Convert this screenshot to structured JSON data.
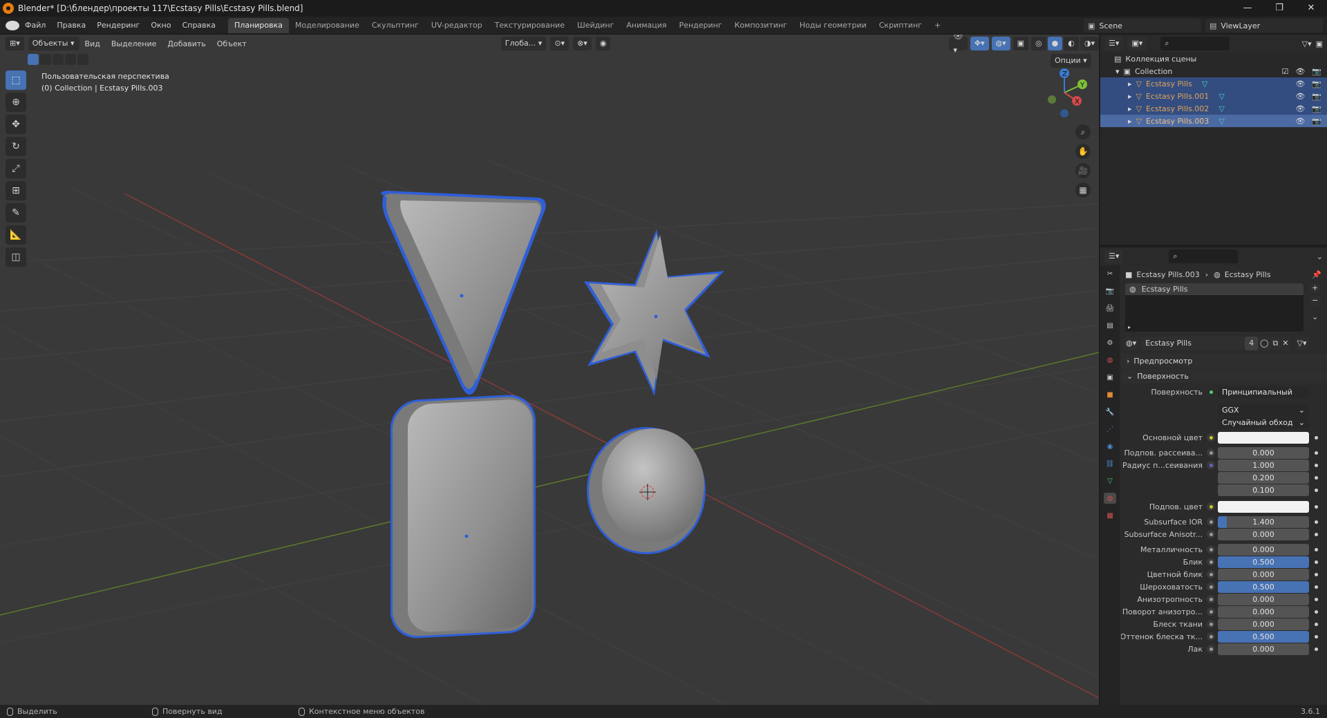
{
  "window": {
    "title": "Blender* [D:\\блендер\\проекты 117\\Ecstasy Pills\\Ecstasy Pills.blend]",
    "minimize": "—",
    "maximize": "❐",
    "close": "✕"
  },
  "menu": {
    "items": [
      "Файл",
      "Правка",
      "Рендеринг",
      "Окно",
      "Справка"
    ],
    "workspaces": [
      "Планировка",
      "Моделирование",
      "Скульптинг",
      "UV-редактор",
      "Текстурирование",
      "Шейдинг",
      "Анимация",
      "Рендеринг",
      "Композитинг",
      "Ноды геометрии",
      "Скриптинг",
      "+"
    ],
    "active_workspace": "Планировка",
    "scene": "Scene",
    "view_layer": "ViewLayer"
  },
  "viewport": {
    "mode": "Объекты",
    "menus": [
      "Вид",
      "Выделение",
      "Добавить",
      "Объект"
    ],
    "transform_orientation": "Глоба...",
    "options": "Опции",
    "info_line1": "Пользовательская перспектива",
    "info_line2": "(0) Collection | Ecstasy Pills.003",
    "gizmo": {
      "z": "Z",
      "y": "Y",
      "x": "X"
    }
  },
  "outliner": {
    "scene_collection": "Коллекция сцены",
    "collection": "Collection",
    "objects": [
      {
        "name": "Ecstasy Pills",
        "selected": true
      },
      {
        "name": "Ecstasy Pills.001",
        "selected": true
      },
      {
        "name": "Ecstasy Pills.002",
        "selected": true
      },
      {
        "name": "Ecstasy Pills.003",
        "selected": true,
        "active": true
      }
    ]
  },
  "properties": {
    "breadcrumb_object": "Ecstasy Pills.003",
    "breadcrumb_material": "Ecstasy Pills",
    "slot_name": "Ecstasy Pills",
    "material_name": "Ecstasy Pills",
    "user_count": "4",
    "section_preview": "Предпросмотр",
    "section_surface": "Поверхность",
    "surface_label": "Поверхность",
    "surface_value": "Принципиальный BSDF",
    "distribution": "GGX",
    "subsurface_method": "Случайный обход",
    "fields": [
      {
        "label": "Основной цвет",
        "value": "",
        "type": "color",
        "dot": "y"
      },
      {
        "label": "Подпов. рассеива...",
        "value": "0.000",
        "fill": 0,
        "dot": "g"
      },
      {
        "label": "Радиус п...сеивания",
        "value": "1.000",
        "fill": 0,
        "dot": "p"
      },
      {
        "label": "",
        "value": "0.200",
        "fill": 0,
        "dot": ""
      },
      {
        "label": "",
        "value": "0.100",
        "fill": 0,
        "dot": ""
      },
      {
        "label": "Подпов. цвет",
        "value": "",
        "type": "color",
        "dot": "y"
      },
      {
        "label": "Subsurface IOR",
        "value": "1.400",
        "fill": 0.1,
        "dot": "g"
      },
      {
        "label": "Subsurface Anisotr...",
        "value": "0.000",
        "fill": 0,
        "dot": "g"
      },
      {
        "label": "Металличность",
        "value": "0.000",
        "fill": 0,
        "dot": "g"
      },
      {
        "label": "Блик",
        "value": "0.500",
        "fill": 1,
        "dot": "g"
      },
      {
        "label": "Цветной блик",
        "value": "0.000",
        "fill": 0,
        "dot": "g"
      },
      {
        "label": "Шероховатость",
        "value": "0.500",
        "fill": 1,
        "dot": "g"
      },
      {
        "label": "Анизотропность",
        "value": "0.000",
        "fill": 0,
        "dot": "g"
      },
      {
        "label": "Поворот анизотро...",
        "value": "0.000",
        "fill": 0,
        "dot": "g"
      },
      {
        "label": "Блеск ткани",
        "value": "0.000",
        "fill": 0,
        "dot": "g"
      },
      {
        "label": "Оттенок блеска тк...",
        "value": "0.500",
        "fill": 1,
        "dot": "g"
      },
      {
        "label": "Лак",
        "value": "0.000",
        "fill": 0,
        "dot": "g"
      }
    ]
  },
  "status": {
    "select": "Выделить",
    "rotate": "Повернуть вид",
    "context": "Контекстное меню объектов",
    "version": "3.6.1"
  },
  "colors": {
    "accent": "#4772b3",
    "selected_object": "#e0a35a",
    "outline": "#2f5fd8"
  }
}
